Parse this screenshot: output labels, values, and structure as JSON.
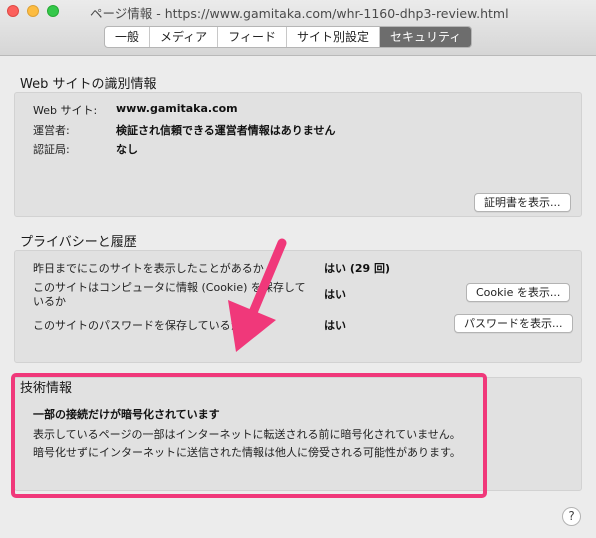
{
  "window": {
    "title": "ページ情報 - https://www.gamitaka.com/whr-1160-dhp3-review.html"
  },
  "tabs": [
    {
      "label": "一般",
      "active": false
    },
    {
      "label": "メディア",
      "active": false
    },
    {
      "label": "フィード",
      "active": false
    },
    {
      "label": "サイト別設定",
      "active": false
    },
    {
      "label": "セキュリティ",
      "active": true
    }
  ],
  "identity": {
    "title": "Web サイトの識別情報",
    "website_label": "Web サイト:",
    "website_value": "www.gamitaka.com",
    "owner_label": "運営者:",
    "owner_value": "検証され信頼できる運営者情報はありません",
    "verifier_label": "認証局:",
    "verifier_value": "なし",
    "view_cert_button": "証明書を表示..."
  },
  "privacy": {
    "title": "プライバシーと履歴",
    "q1": "昨日までにこのサイトを表示したことがあるか",
    "a1": "はい (29 回)",
    "q2_line1": "このサイトはコンピュータに情報 (Cookie) を保存して",
    "q2_line2": "いるか",
    "a2": "はい",
    "cookie_button": "Cookie を表示...",
    "q3": "このサイトのパスワードを保存しているか",
    "a3": "はい",
    "password_button": "パスワードを表示..."
  },
  "technical": {
    "title": "技術情報",
    "heading": "一部の接続だけが暗号化されています",
    "line1": "表示しているページの一部はインターネットに転送される前に暗号化されていません。",
    "line2": "暗号化せずにインターネットに送信された情報は他人に傍受される可能性があります。"
  },
  "help": {
    "symbol": "?"
  },
  "colors": {
    "annotation": "#f0387a",
    "active_tab": "#6d6d6d"
  }
}
